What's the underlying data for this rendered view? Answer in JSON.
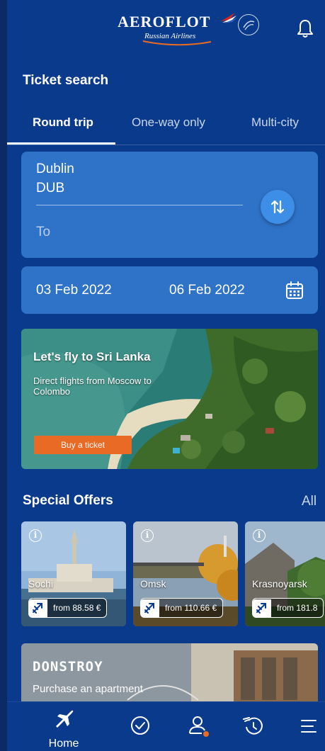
{
  "header": {
    "brand": "AEROFLOT",
    "brand_sub": "Russian Airlines",
    "icons": [
      "skyteam-icon",
      "bell-icon"
    ]
  },
  "search": {
    "title": "Ticket search",
    "tabs": [
      {
        "label": "Round trip",
        "active": true
      },
      {
        "label": "One-way only",
        "active": false
      },
      {
        "label": "Multi-city",
        "active": false
      }
    ],
    "from_city": "Dublin",
    "from_code": "DUB",
    "to_placeholder": "To",
    "date_depart": "03 Feb 2022",
    "date_return": "06 Feb 2022"
  },
  "banner": {
    "title": "Let's fly to Sri Lanka",
    "subtitle": "Direct flights from Moscow to Colombo",
    "button": "Buy a ticket"
  },
  "offers": {
    "title": "Special Offers",
    "all_label": "All",
    "items": [
      {
        "city": "Sochi",
        "price": "from 88.58 €"
      },
      {
        "city": "Omsk",
        "price": "from 110.66 €"
      },
      {
        "city": "Krasnoyarsk",
        "price": "from 181.8"
      }
    ]
  },
  "promo": {
    "title": "DONSTROY",
    "subtitle": "Purchase an apartment"
  },
  "nav": {
    "home_label": "Home",
    "items": [
      "plane-icon",
      "check-circle-icon",
      "profile-icon",
      "history-icon",
      "menu-icon"
    ]
  },
  "colors": {
    "background": "#0a3a8c",
    "card": "#2f73c9",
    "accent": "#e86a24",
    "swap_button": "#3d8ee6"
  }
}
